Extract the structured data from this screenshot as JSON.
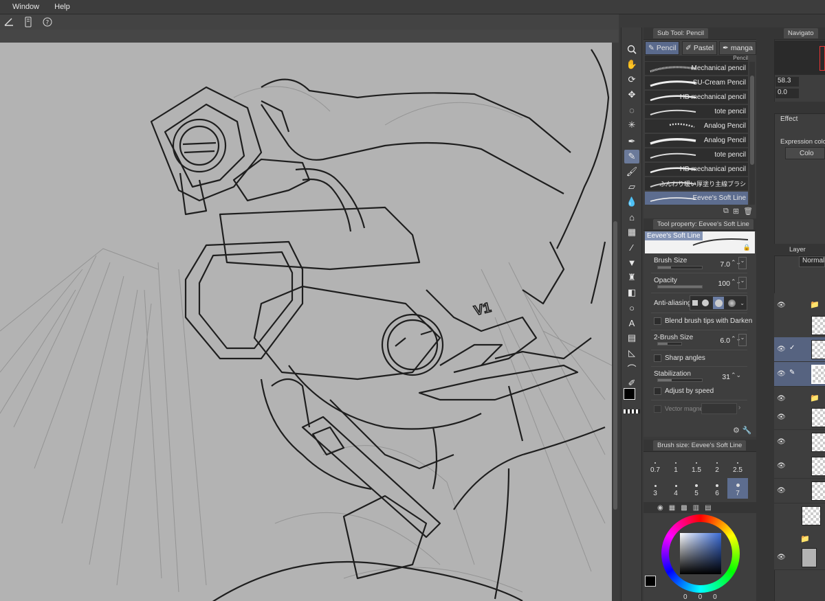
{
  "menu": [
    "Window",
    "Help"
  ],
  "subtool_panel": {
    "title": "Sub Tool: Pencil",
    "tabs": [
      "Pencil",
      "Pastel",
      "manga"
    ],
    "header_partial": "Pencil",
    "brushes": [
      "Mechanical pencil",
      "SU-Cream Pencil",
      "HB mechanical pencil",
      "tote pencil",
      "Analog Pencil",
      "Analog Pencil",
      "tote pencil",
      "HB mechanical pencil",
      "ふんわり暖い厚塗り主線ブラシ",
      "Eevee's Soft Line"
    ]
  },
  "tool_property": {
    "title": "Tool property: Eevee's Soft Line",
    "preview_name": "Eevee's Soft Line",
    "brush_size": {
      "label": "Brush Size",
      "value": "7.0"
    },
    "opacity": {
      "label": "Opacity",
      "value": "100"
    },
    "anti_aliasing": {
      "label": "Anti-aliasing"
    },
    "blend": {
      "label": "Blend brush tips with Darken"
    },
    "brush2": {
      "label": "2-Brush Size",
      "value": "6.0"
    },
    "sharp": {
      "label": "Sharp angles"
    },
    "stabilization": {
      "label": "Stabilization",
      "value": "31"
    },
    "adjust_speed": {
      "label": "Adjust by speed"
    },
    "vector_magnet": {
      "label": "Vector magnet"
    }
  },
  "brush_size_panel": {
    "title": "Brush size: Eevee's Soft Line",
    "sizes": [
      "0.7",
      "1",
      "1.5",
      "2",
      "2.5",
      "3",
      "4",
      "5",
      "6",
      "7"
    ],
    "selected": "7"
  },
  "color_values": {
    "r": "0",
    "g": "0",
    "b": "0"
  },
  "navigator": {
    "title": "Navigato",
    "zoom": "58.3",
    "rotation": "0.0"
  },
  "layer_property": {
    "effect_label": "Effect",
    "expression_label": "Expression colo",
    "color_button": "Colo"
  },
  "layer_panel": {
    "title": "Layer",
    "blend_mode": "Normal"
  },
  "drawing": {
    "label": "V1"
  },
  "colors": {
    "selection": "#5d6d8f",
    "canvas_bg": "#b3b3b3",
    "panel_bg": "#3e3e3e"
  }
}
